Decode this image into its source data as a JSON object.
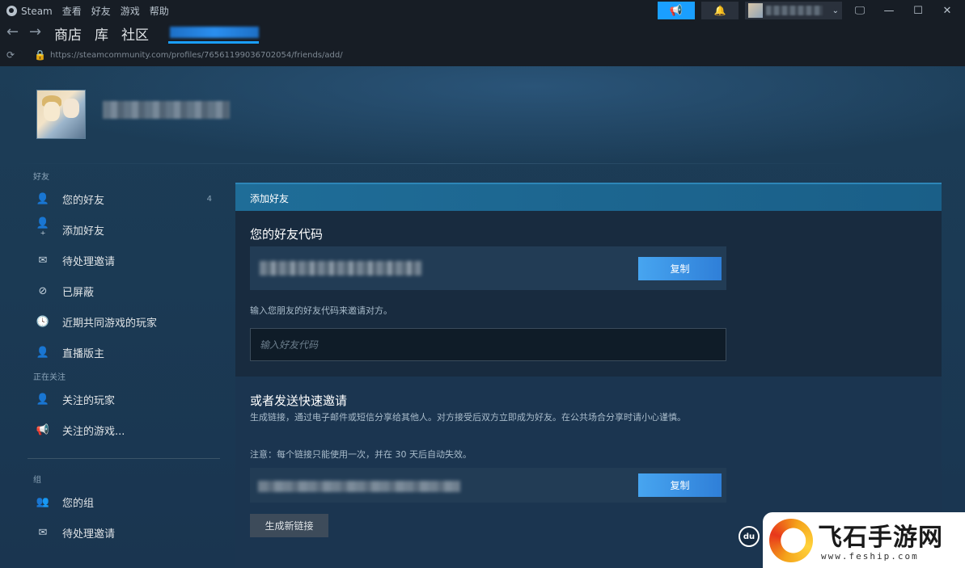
{
  "titlebar": {
    "app_name": "Steam",
    "menu": [
      "查看",
      "好友",
      "游戏",
      "帮助"
    ]
  },
  "nav": {
    "links": [
      "商店",
      "库",
      "社区"
    ]
  },
  "url": "https://steamcommunity.com/profiles/76561199036702054/friends/add/",
  "sidebar": {
    "friends_header": "好友",
    "friends_items": [
      {
        "label": "您的好友",
        "icon": "person-icon",
        "count": "4"
      },
      {
        "label": "添加好友",
        "icon": "add-person-icon"
      },
      {
        "label": "待处理邀请",
        "icon": "mail-icon"
      },
      {
        "label": "已屏蔽",
        "icon": "block-icon"
      },
      {
        "label": "近期共同游戏的玩家",
        "icon": "clock-icon"
      },
      {
        "label": "直播版主",
        "icon": "person-icon"
      }
    ],
    "following_header": "正在关注",
    "following_items": [
      {
        "label": "关注的玩家",
        "icon": "follow-person-icon"
      },
      {
        "label": "关注的游戏...",
        "icon": "megaphone-icon"
      }
    ],
    "groups_header": "组",
    "groups_items": [
      {
        "label": "您的组",
        "icon": "group-icon"
      },
      {
        "label": "待处理邀请",
        "icon": "mail-icon"
      }
    ]
  },
  "panel": {
    "header": "添加好友",
    "friend_code_title": "您的好友代码",
    "copy_label": "复制",
    "enter_hint": "输入您朋友的好友代码来邀请对方。",
    "input_placeholder": "输入好友代码",
    "quick_invite_title": "或者发送快速邀请",
    "quick_invite_desc": "生成链接，通过电子邮件或短信分享给其他人。对方接受后双方立即成为好友。在公共场合分享时请小心谨慎。",
    "note": "注意：每个链接只能使用一次，并在 30 天后自动失效。",
    "copy_label_2": "复制",
    "generate_label": "生成新链接"
  },
  "watermark": {
    "du": "du",
    "title": "飞石手游网",
    "url": "www.feship.com"
  },
  "colors": {
    "accent": "#1a9fff",
    "panel_header": "#1f6d98",
    "background": "#1b3a54"
  }
}
